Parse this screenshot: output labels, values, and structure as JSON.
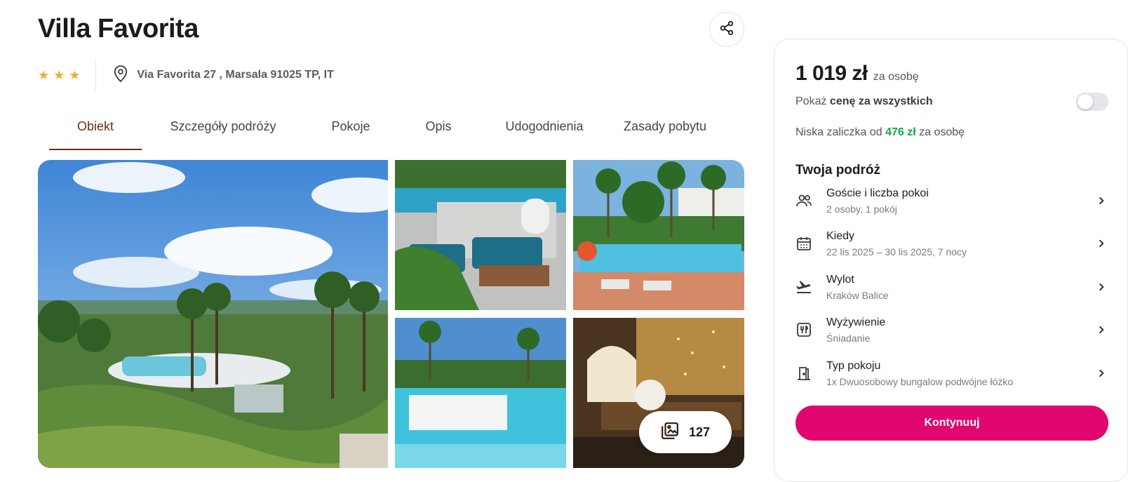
{
  "hotel": {
    "name": "Villa Favorita",
    "stars": 3,
    "address": "Via Favorita 27 , Marsala 91025 TP, IT"
  },
  "tabs": [
    {
      "label": "Obiekt",
      "active": true
    },
    {
      "label": "Szczegóły podróży",
      "active": false
    },
    {
      "label": "Pokoje",
      "active": false
    },
    {
      "label": "Opis",
      "active": false
    },
    {
      "label": "Udogodnienia",
      "active": false
    },
    {
      "label": "Zasady pobytu",
      "active": false
    }
  ],
  "gallery": {
    "photo_count": "127",
    "icons": {
      "share": "share-icon",
      "gallery": "photo-gallery-icon"
    }
  },
  "booking": {
    "price": "1 019 zł",
    "price_per": "za osobę",
    "toggle_prefix": "Pokaż",
    "toggle_bold": "cenę za wszystkich",
    "toggle_on": false,
    "deposit_prefix": "Niska zaliczka od",
    "deposit_amount": "476 zł",
    "deposit_suffix": "za osobę",
    "trip_title": "Twoja podróż",
    "items": [
      {
        "label": "Goście i liczba pokoi",
        "value": "2 osoby, 1 pokój",
        "icon": "guests-icon"
      },
      {
        "label": "Kiedy",
        "value": "22 lis 2025 – 30 lis 2025, 7 nocy",
        "icon": "calendar-icon"
      },
      {
        "label": "Wylot",
        "value": "Kraków Balice",
        "icon": "plane-departure-icon"
      },
      {
        "label": "Wyżywienie",
        "value": "Śniadanie",
        "icon": "meal-icon"
      },
      {
        "label": "Typ pokoju",
        "value": "1x Dwuosobowy bungalow podwójne łóżko",
        "icon": "room-door-icon"
      }
    ],
    "cta_label": "Kontynuuj"
  },
  "colors": {
    "star": "#f2a93b",
    "active_tab": "#6e2f12",
    "deposit_green": "#15a34a",
    "cta": "#e2066f"
  }
}
